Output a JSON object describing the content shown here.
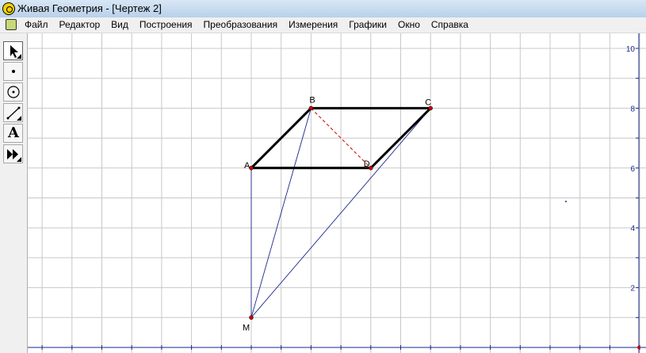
{
  "window": {
    "title": "Живая Геометрия - [Чертеж 2]"
  },
  "menu": {
    "items": [
      "Файл",
      "Редактор",
      "Вид",
      "Построения",
      "Преобразования",
      "Измерения",
      "Графики",
      "Окно",
      "Справка"
    ]
  },
  "toolbox": {
    "tools": [
      {
        "name": "arrow-select-tool",
        "icon": "arrow-icon",
        "active": true
      },
      {
        "name": "point-tool",
        "icon": "point-icon"
      },
      {
        "name": "compass-tool",
        "icon": "circle-icon"
      },
      {
        "name": "straightedge-tool",
        "icon": "segment-icon"
      },
      {
        "name": "text-tool",
        "icon": "text-a-icon",
        "label": "A"
      },
      {
        "name": "custom-tool",
        "icon": "fast-forward-icon"
      }
    ]
  },
  "canvas": {
    "colors": {
      "grid": "#c8c8c8",
      "axis": "#1a2a8a",
      "figure": "#000000",
      "point": "#cc0000",
      "dashed": "#cc0000",
      "construction": "#1a2a8a"
    },
    "y_axis_labels": [
      "10",
      "8",
      "6",
      "4",
      "2"
    ],
    "points": [
      {
        "label": "A",
        "x": 0,
        "y": 6
      },
      {
        "label": "B",
        "x": 2,
        "y": 8
      },
      {
        "label": "C",
        "x": 6,
        "y": 8
      },
      {
        "label": "D",
        "x": 4,
        "y": 6
      },
      {
        "label": "M",
        "x": 0,
        "y": 1
      }
    ],
    "bold_segments": [
      [
        "A",
        "B"
      ],
      [
        "B",
        "C"
      ],
      [
        "C",
        "D"
      ],
      [
        "D",
        "A"
      ]
    ],
    "dashed_segments": [
      [
        "B",
        "D"
      ]
    ],
    "thin_segments": [
      [
        "M",
        "A"
      ],
      [
        "M",
        "B"
      ],
      [
        "M",
        "C"
      ]
    ]
  }
}
